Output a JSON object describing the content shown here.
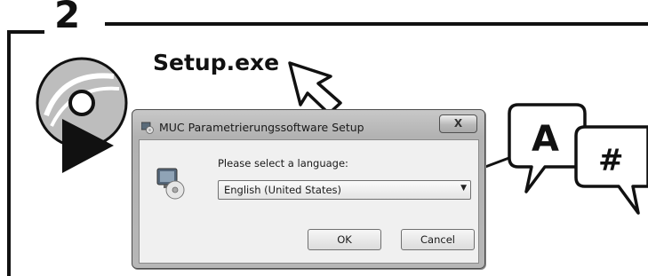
{
  "step": {
    "number": "2"
  },
  "instruction": {
    "file_label": "Setup.exe"
  },
  "dialog": {
    "title": "MUC Parametrierungssoftware Setup",
    "close_label": "X",
    "prompt": "Please select a language:",
    "language_select": {
      "selected": "English (United States)"
    },
    "ok_label": "OK",
    "cancel_label": "Cancel"
  },
  "bubbles": {
    "letter": "A",
    "symbol": "#"
  },
  "icons": {
    "disc": "cd-disc-icon",
    "play": "play-triangle-icon",
    "cursor": "mouse-cursor-icon",
    "pointer": "pointer-arrow-icon",
    "app": "installer-computer-icon",
    "title": "setup-window-icon"
  }
}
